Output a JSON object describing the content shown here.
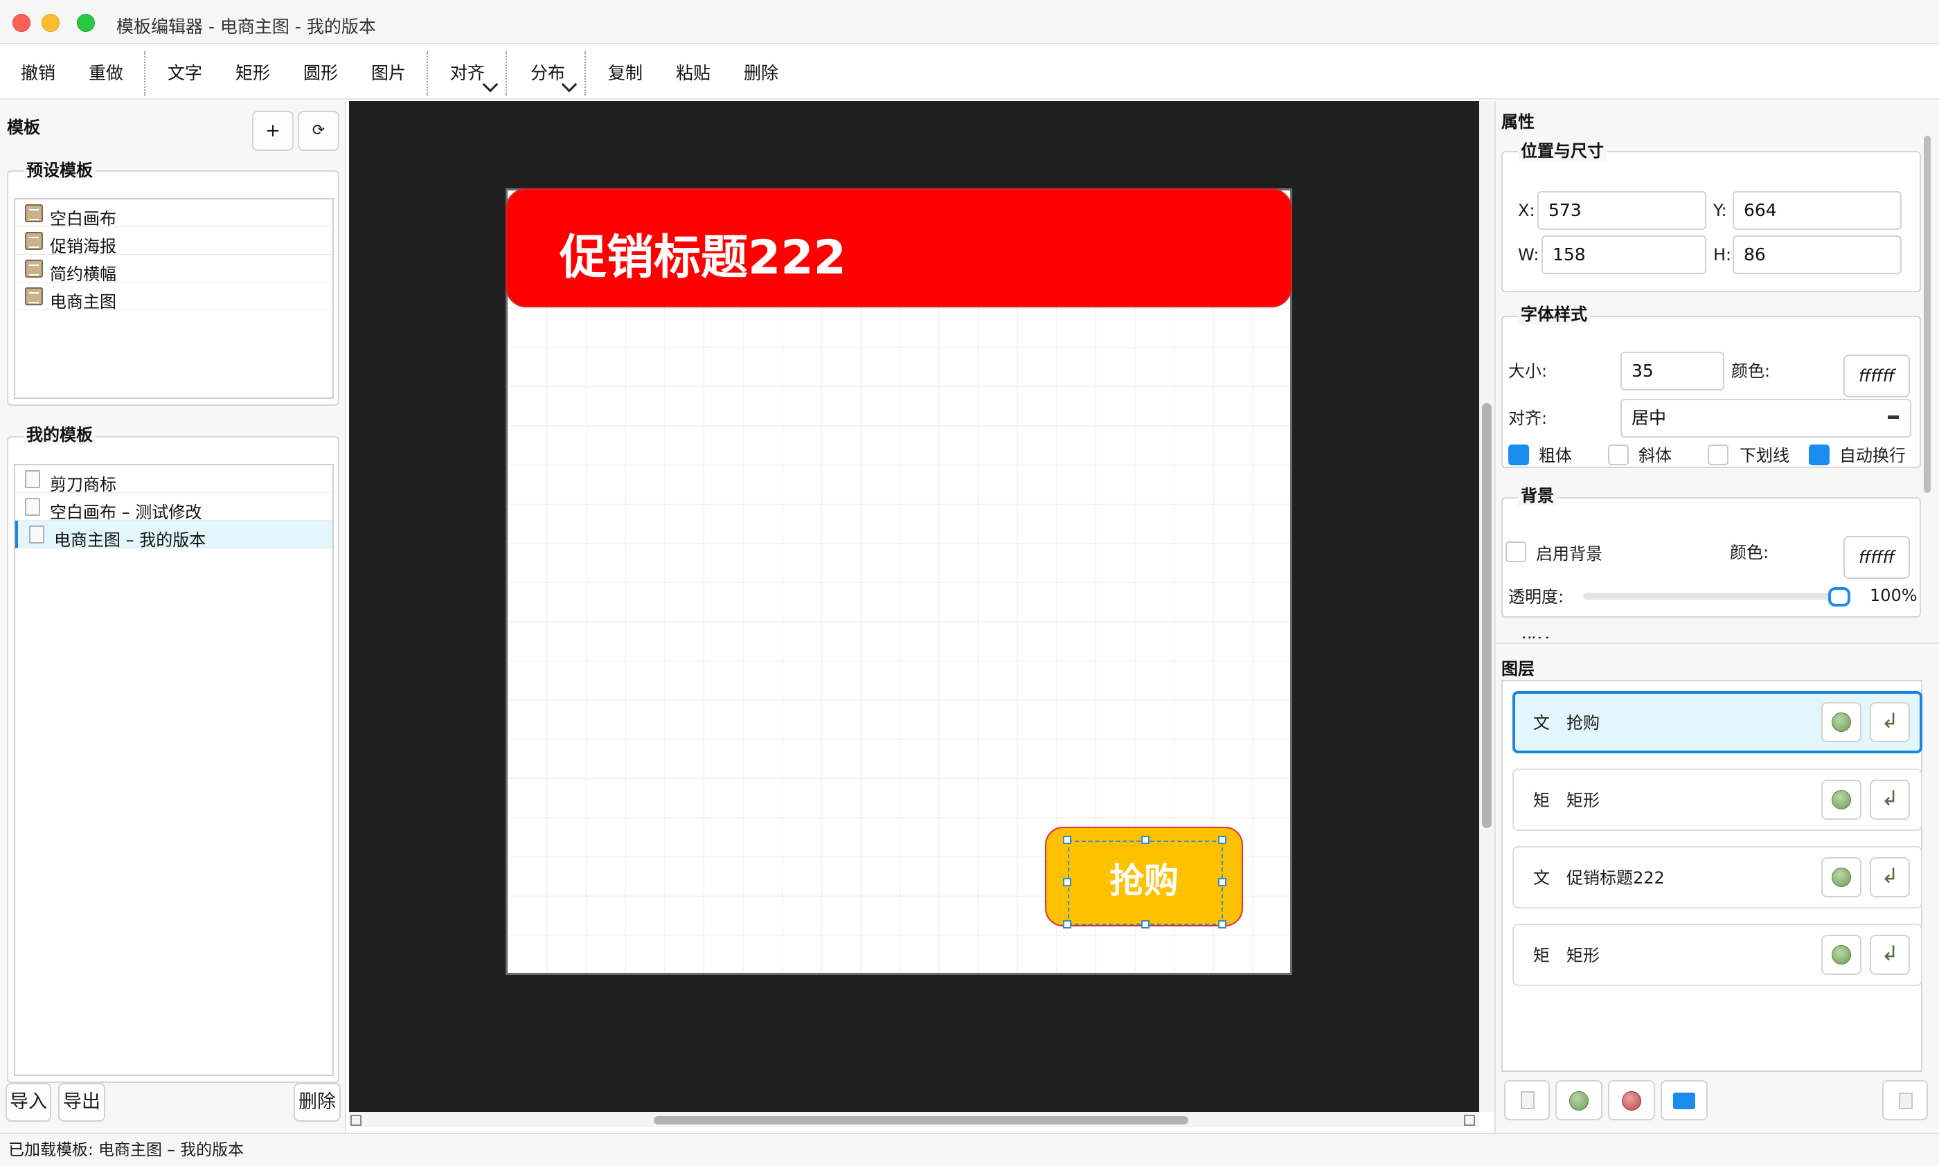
{
  "window": {
    "title": "模板编辑器 - 电商主图 - 我的版本"
  },
  "toolbar": {
    "undo": "撤销",
    "redo": "重做",
    "text": "文字",
    "rect": "矩形",
    "circle": "圆形",
    "image": "图片",
    "align": "对齐",
    "distribute": "分布",
    "copy": "复制",
    "paste": "粘贴",
    "delete": "删除"
  },
  "left": {
    "title": "模板",
    "add_btn": "+",
    "refresh_btn": "⟳",
    "preset_title": "预设模板",
    "presets": [
      "空白画布",
      "促销海报",
      "简约横幅",
      "电商主图"
    ],
    "mine_title": "我的模板",
    "mine": [
      "剪刀商标",
      "空白画布 – 测试修改",
      "电商主图 – 我的版本"
    ],
    "import": "导入",
    "export": "导出",
    "delete": "删除"
  },
  "canvas": {
    "banner_text": "促销标题222",
    "button_text": "抢购"
  },
  "props": {
    "title": "属性",
    "pos_title": "位置与尺寸",
    "x_label": "X:",
    "x": "573",
    "y_label": "Y:",
    "y": "664",
    "w_label": "W:",
    "w": "158",
    "h_label": "H:",
    "h": "86",
    "font_title": "字体样式",
    "size_label": "大小:",
    "size": "35",
    "color_label": "颜色:",
    "font_color": "ffffff",
    "align_label": "对齐:",
    "align": "居中",
    "bold": "粗体",
    "italic": "斜体",
    "underline": "下划线",
    "wrap": "自动换行",
    "bg_title": "背景",
    "bg_enable": "启用背景",
    "bg_color_label": "颜色:",
    "bg_color": "ffffff",
    "opacity_label": "透明度:",
    "opacity": "100%",
    "stroke_title": "描边"
  },
  "layers": {
    "title": "图层",
    "items": [
      {
        "type": "文",
        "name": "抢购"
      },
      {
        "type": "矩",
        "name": "矩形"
      },
      {
        "type": "文",
        "name": "促销标题222"
      },
      {
        "type": "矩",
        "name": "矩形"
      }
    ]
  },
  "status": {
    "text": "已加载模板: 电商主图 – 我的版本"
  },
  "colors": {
    "accent": "#1a8cf0",
    "banner": "#ff0000",
    "button": "#ffc000",
    "canvas_bg": "#1f1f1f"
  }
}
